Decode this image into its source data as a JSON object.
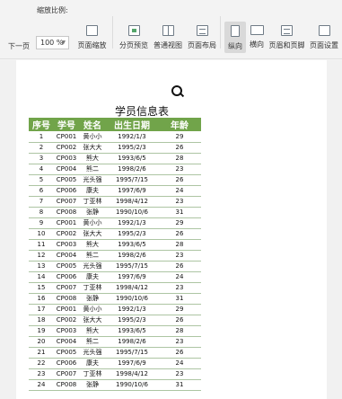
{
  "toolbar": {
    "prev_page": "下一页",
    "scale_label": "缩放比例:",
    "zoom_value": "100 %",
    "page_zoom": "页面缩放",
    "page_break_preview": "分页预览",
    "normal_view": "普通视图",
    "page_layout": "页面布局",
    "portrait": "纵向",
    "landscape": "横向",
    "header_footer": "页眉和页脚",
    "page_setup": "页面设置"
  },
  "sheet": {
    "title": "学员信息表",
    "headers": [
      "序号",
      "学号",
      "姓名",
      "出生日期",
      "年龄"
    ],
    "rows": [
      [
        "1",
        "CP001",
        "黄小小",
        "1992/1/3",
        "29"
      ],
      [
        "2",
        "CP002",
        "张大大",
        "1995/2/3",
        "26"
      ],
      [
        "3",
        "CP003",
        "熊大",
        "1993/6/5",
        "28"
      ],
      [
        "4",
        "CP004",
        "熊二",
        "1998/2/6",
        "23"
      ],
      [
        "5",
        "CP005",
        "光头强",
        "1995/7/15",
        "26"
      ],
      [
        "6",
        "CP006",
        "康夫",
        "1997/6/9",
        "24"
      ],
      [
        "7",
        "CP007",
        "丁亚林",
        "1998/4/12",
        "23"
      ],
      [
        "8",
        "CP008",
        "张静",
        "1990/10/6",
        "31"
      ],
      [
        "9",
        "CP001",
        "黄小小",
        "1992/1/3",
        "29"
      ],
      [
        "10",
        "CP002",
        "张大大",
        "1995/2/3",
        "26"
      ],
      [
        "11",
        "CP003",
        "熊大",
        "1993/6/5",
        "28"
      ],
      [
        "12",
        "CP004",
        "熊二",
        "1998/2/6",
        "23"
      ],
      [
        "13",
        "CP005",
        "光头强",
        "1995/7/15",
        "26"
      ],
      [
        "14",
        "CP006",
        "康夫",
        "1997/6/9",
        "24"
      ],
      [
        "15",
        "CP007",
        "丁亚林",
        "1998/4/12",
        "23"
      ],
      [
        "16",
        "CP008",
        "张静",
        "1990/10/6",
        "31"
      ],
      [
        "17",
        "CP001",
        "黄小小",
        "1992/1/3",
        "29"
      ],
      [
        "18",
        "CP002",
        "张大大",
        "1995/2/3",
        "26"
      ],
      [
        "19",
        "CP003",
        "熊大",
        "1993/6/5",
        "28"
      ],
      [
        "20",
        "CP004",
        "熊二",
        "1998/2/6",
        "23"
      ],
      [
        "21",
        "CP005",
        "光头强",
        "1995/7/15",
        "26"
      ],
      [
        "22",
        "CP006",
        "康夫",
        "1997/6/9",
        "24"
      ],
      [
        "23",
        "CP007",
        "丁亚林",
        "1998/4/12",
        "23"
      ],
      [
        "24",
        "CP008",
        "张静",
        "1990/10/6",
        "31"
      ]
    ]
  }
}
